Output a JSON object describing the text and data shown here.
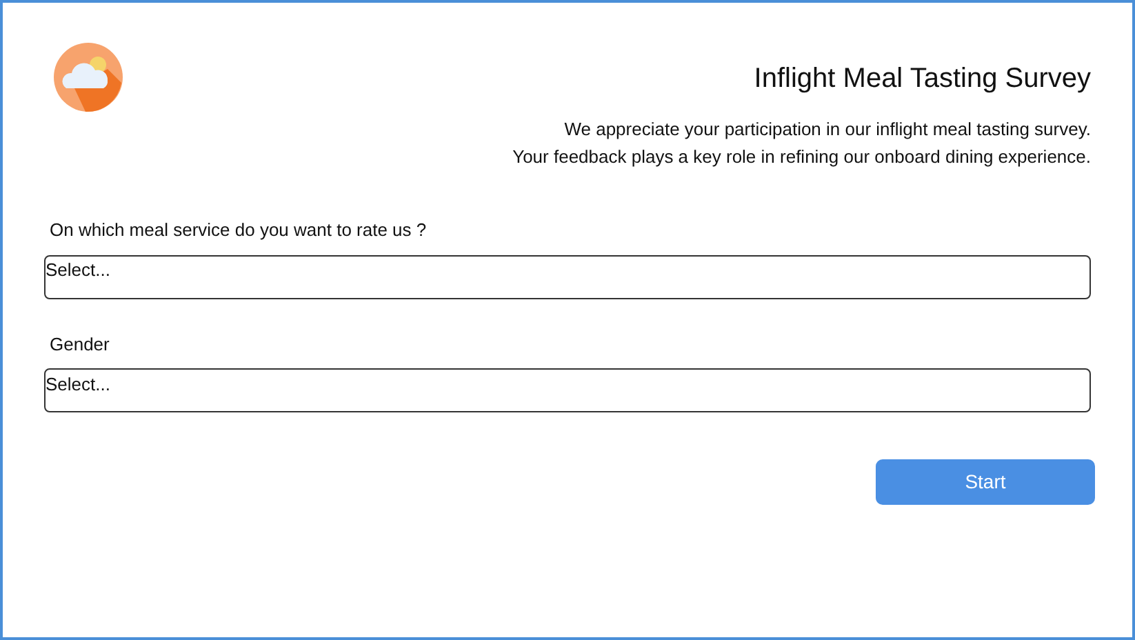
{
  "title": "Inflight Meal Tasting Survey",
  "intro": [
    "We appreciate your participation in our inflight meal tasting survey.",
    "Your feedback plays a key role in refining our onboard dining experience."
  ],
  "fields": [
    {
      "label": "On which meal service do you want to rate us ?",
      "placeholder": "Select..."
    },
    {
      "label": "Gender",
      "placeholder": "Select..."
    }
  ],
  "button": "Start"
}
